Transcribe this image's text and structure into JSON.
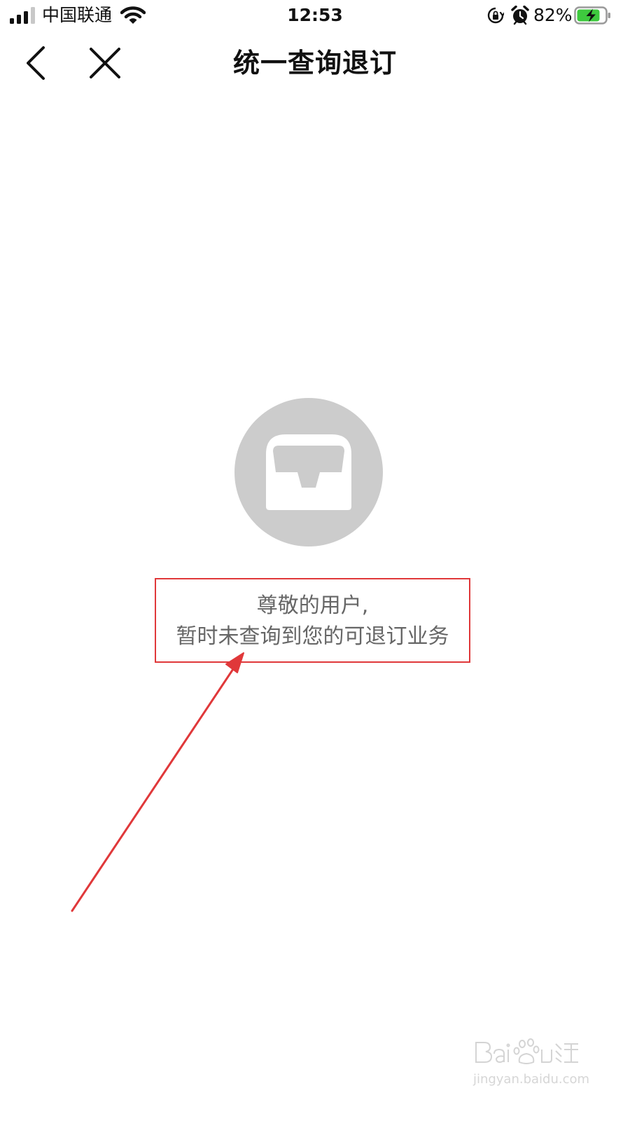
{
  "status_bar": {
    "carrier": "中国联通",
    "time": "12:53",
    "battery_percent": "82%",
    "battery_level": 0.82,
    "icons": [
      "signal-icon",
      "wifi-icon",
      "rotation-lock-icon",
      "alarm-icon",
      "battery-charging-icon"
    ]
  },
  "nav": {
    "title": "统一查询退订",
    "icons": [
      "back-chevron-icon",
      "close-icon"
    ]
  },
  "empty_state": {
    "icon": "empty-inbox-icon",
    "line1": "尊敬的用户,",
    "line2": "暂时未查询到您的可退订业务"
  },
  "annotation": {
    "color": "#e0383a"
  },
  "watermark": {
    "logo_text": "Baidu经验",
    "url": "jingyan.baidu.com"
  },
  "colors": {
    "battery_green": "#3ec93e",
    "empty_circle": "#cccccc",
    "message_text": "#666666"
  }
}
